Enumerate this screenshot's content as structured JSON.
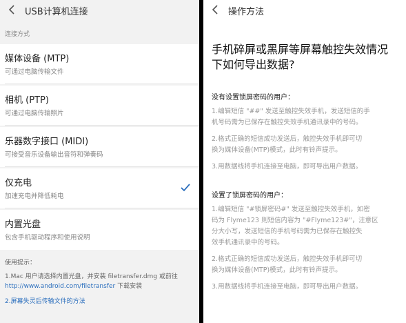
{
  "left": {
    "header_title": "USB计算机连接",
    "section_label": "连接方式",
    "items": [
      {
        "title": "媒体设备 (MTP)",
        "subtitle": "可通过电脑传输文件"
      },
      {
        "title": "相机 (PTP)",
        "subtitle": "可通过电脑传输照片"
      },
      {
        "title": "乐器数字接口 (MIDI)",
        "subtitle": "可接受音乐设备输出音符和弹奏码"
      },
      {
        "title": "仅充电",
        "subtitle": "加速充电并降低耗电",
        "checked": true
      },
      {
        "title": "内置光盘",
        "subtitle": "包含手机驱动程序和使用说明"
      }
    ],
    "tips": {
      "heading": "使用提示：",
      "line1": "1.Mac 用户请选择内置光盘，并安装 filetransfer.dmg 或前往",
      "line2_link": "http://www.android.com/filetransfer",
      "line2_text": " 下载安装",
      "line3_link": "2.屏幕失灵后传输文件的方法"
    },
    "accent_color": "#2a6ebd"
  },
  "right": {
    "header_title": "操作方法",
    "question_line1": "手机碎屏或黑屏等屏幕触控失效情况",
    "question_line2": "下如何导出数据?",
    "section1": {
      "heading": "没有设置锁屏密码的用户：",
      "step1_l1": "1.编辑短信 \"##\" 发送至触控失效手机，发送短信的手",
      "step1_l2": "机号码需为已保存在触控失效手机通讯录中的号码。",
      "step2_l1": "2.格式正确的短信成功发送后，触控失效手机即可切",
      "step2_l2": "换为媒体设备(MTP)模式，此时有铃声提示。",
      "step3": "3.用数据线将手机连接至电脑，即可导出用户数据。"
    },
    "section2": {
      "heading": "设置了锁屏密码的用户：",
      "step1_l1": "1.编辑短信 \"#锁屏密码#\" 发送至触控失效手机，如密",
      "step1_l2": "码为 Flyme123 则短信内容为 \"#Flyme123#\"，注意区",
      "step1_l3": "分大小写，发送短信的手机号码需为已保存在触控失",
      "step1_l4": "效手机通讯录中的号码。",
      "step2_l1": "2.格式正确的短信成功发送后，触控失效手机即可切",
      "step2_l2": "换为媒体设备(MTP)模式，此时有铃声提示。",
      "step3": "3.用数据线将手机连接至电脑，即可导出用户数据。"
    }
  }
}
